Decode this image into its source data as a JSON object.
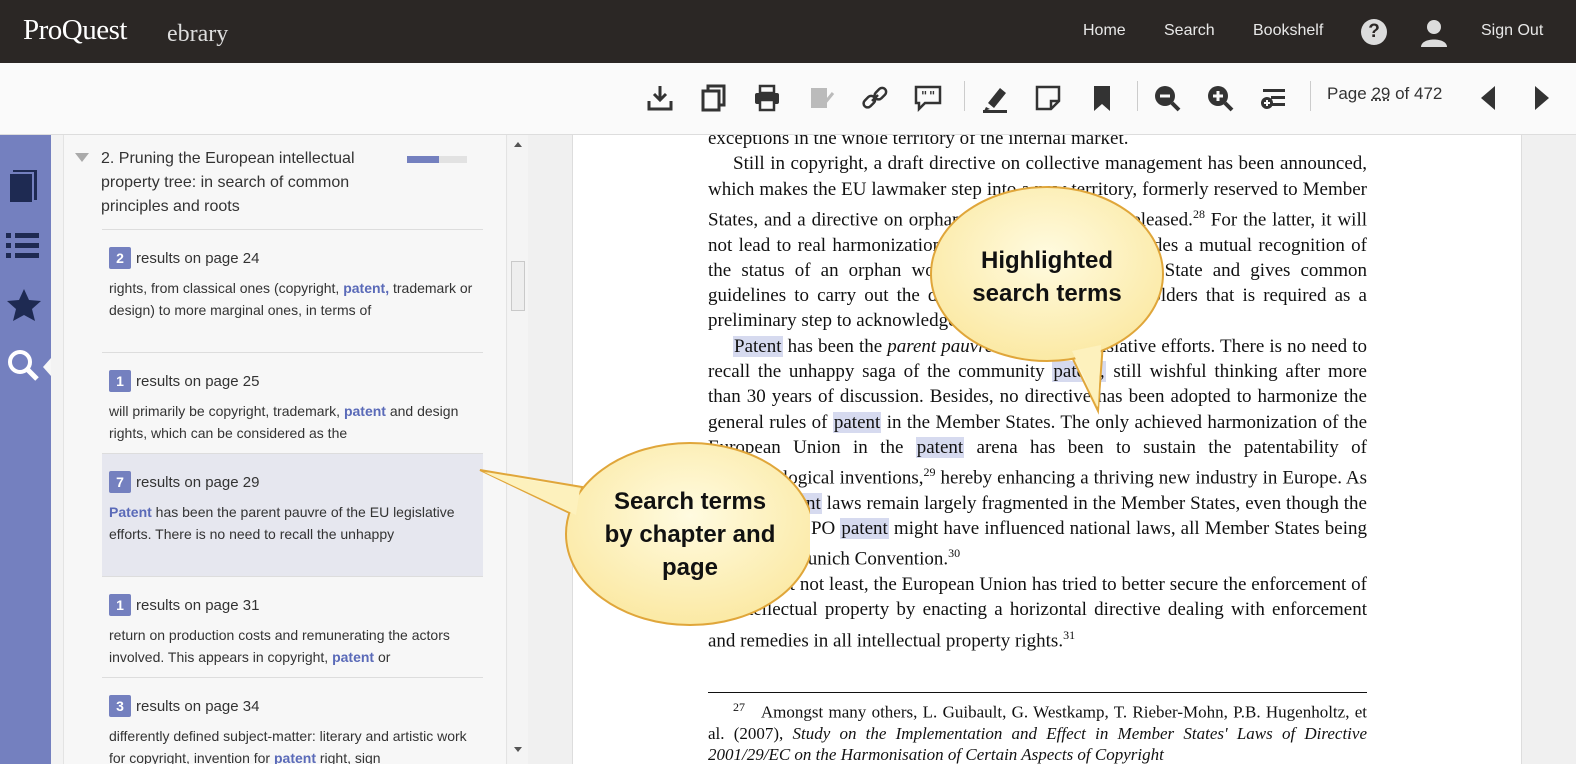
{
  "header": {
    "brand": "ProQuest",
    "sub_brand": "ebrary",
    "nav": [
      "Home",
      "Search",
      "Bookshelf"
    ],
    "help_icon": "?",
    "sign_out": "Sign Out"
  },
  "toolbar": {
    "icons": [
      "download-icon",
      "copy-icon",
      "print-icon",
      "export-icon",
      "link-icon",
      "cite-icon",
      "highlight-icon",
      "note-icon",
      "bookmark-icon",
      "zoom-out-icon",
      "zoom-in-icon",
      "zoom-fit-icon",
      "prev-page-icon",
      "next-page-icon"
    ],
    "page_prefix": "Page ",
    "page_number": "29",
    "page_suffix": " of 472"
  },
  "sidebar": {
    "icons": [
      "book-icon",
      "contents-list-icon",
      "favorites-star-icon",
      "search-icon"
    ],
    "accent_color": "#7480bf"
  },
  "results_panel": {
    "chapter_title": "2. Pruning the European intellectual property tree: in search of common principles and roots",
    "chapter_progress": 0.53,
    "results": [
      {
        "count": "2",
        "heading": "results on page 24",
        "before": "rights, from classical ones (copyright, ",
        "term": "patent,",
        "after": " trademark or design) to more marginal ones, in terms of"
      },
      {
        "count": "1",
        "heading": "results on page 25",
        "before": "will primarily be copyright, trademark, ",
        "term": "patent",
        "after": " and design rights, which can be considered as the"
      },
      {
        "count": "7",
        "heading": "results on page 29",
        "before": "",
        "term": "Patent",
        "after": " has been the parent pauvre of the EU legislative efforts. There is no need to recall the unhappy"
      },
      {
        "count": "1",
        "heading": "results on page 31",
        "before": "return on production costs and remunerating the actors involved. This appears in copyright, ",
        "term": "patent",
        "after": " or"
      },
      {
        "count": "3",
        "heading": "results on page 34",
        "before": "differently defined subject-matter: literary and artistic work for copyright, invention for ",
        "term": "patent",
        "after": " right, sign"
      }
    ]
  },
  "document": {
    "line0": "exceptions in the whole territory of the internal market.",
    "p1_a": "Still in copyright, a draft directive on collective management has been announced, which makes the EU lawmaker step into a new territory, formerly reserved to Member States, and a directive on orphan works has just been released.",
    "p1_sup": "28",
    "p1_b": " For the latter, it will not lead to real harmonization as the directive only provides a mutual recognition of the status of an orphan work granted in one Member State and gives common guidelines to carry out the diligent search of the rightholders that is required as a preliminary step to acknowledge a work as orphan.",
    "p2_t1": "Patent",
    "p2_s1": " has been the ",
    "p2_it": "parent pauvre",
    "p2_s2": " of the EU legislative efforts. There is no need to recall the unhappy saga of the community ",
    "p2_t2": "patent,",
    "p2_s3": " still wishful thinking after more than 30 years of discussion. Besides, no directive has been adopted to harmonize the general rules of ",
    "p2_t3": "patent",
    "p2_s4": " in the Member States. The only achieved harmonization of the European Union in the ",
    "p2_t4": "patent",
    "p2_s5": " arena has been to sustain the patentability of biotechnological inventions,",
    "p2_sup1": "29",
    "p2_s6": " hereby enhancing a thriving new industry in Europe. As a result, ",
    "p2_t5": "patent",
    "p2_s7": " laws remain largely fragmented in the Member States, even though the rules of the EPO ",
    "p2_t6": "patent",
    "p2_s8": " might have influenced national laws, all Member States being part of the Munich Convention.",
    "p2_sup2": "30",
    "p3_a": "Last but not least, the European Union has tried to better secure the enforcement of its intellectual property by enacting a horizontal directive dealing with enforcement and remedies in all intellectual property rights.",
    "p3_sup": "31",
    "fn_num": "27",
    "fn_a": "Amongst many others, L. Guibault, G. Westkamp, T. Rieber-Mohn, P.B. Hugenholtz, et al. (2007), ",
    "fn_it": "Study on the Implementation and Effect in Member States' Laws of Directive 2001/29/EC on the Harmonisation of Certain Aspects of Copyright"
  },
  "callouts": {
    "highlight_line1": "Highlighted",
    "highlight_line2": "search terms",
    "search_line1": "Search terms",
    "search_line2": "by chapter and",
    "search_line3": "page"
  }
}
